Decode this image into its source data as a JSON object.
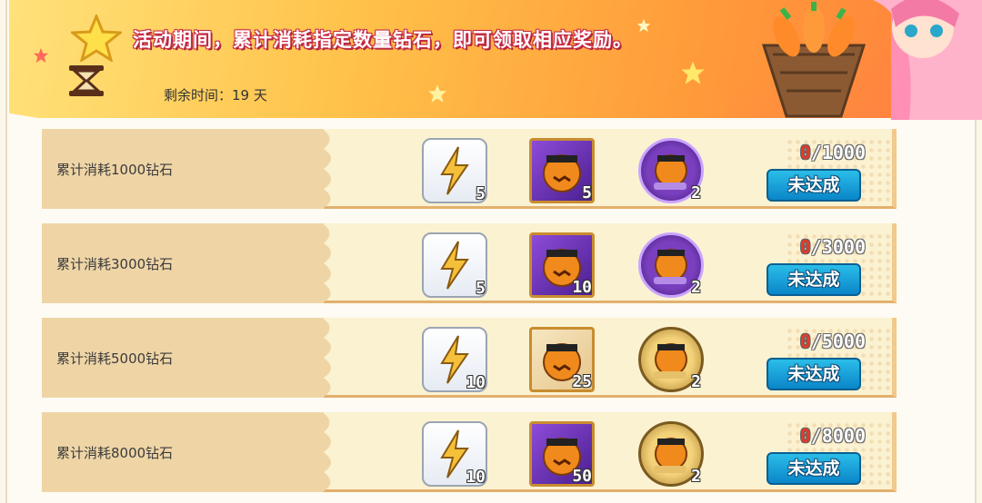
{
  "header": {
    "description": "活动期间，累计消耗指定数量钻石，即可领取相应奖励。",
    "time_label": "剩余时间：",
    "time_value": "19 天"
  },
  "tiers": [
    {
      "label": "累计消耗1000钻石",
      "current": "0",
      "target": "/1000",
      "items": [
        {
          "count": "5"
        },
        {
          "count": "5"
        },
        {
          "count": "2"
        }
      ],
      "button": "未达成"
    },
    {
      "label": "累计消耗3000钻石",
      "current": "0",
      "target": "/3000",
      "items": [
        {
          "count": "5"
        },
        {
          "count": "10"
        },
        {
          "count": "2"
        }
      ],
      "button": "未达成"
    },
    {
      "label": "累计消耗5000钻石",
      "current": "0",
      "target": "/5000",
      "items": [
        {
          "count": "10"
        },
        {
          "count": "25"
        },
        {
          "count": "2"
        }
      ],
      "button": "未达成"
    },
    {
      "label": "累计消耗8000钻石",
      "current": "0",
      "target": "/8000",
      "items": [
        {
          "count": "10"
        },
        {
          "count": "50"
        },
        {
          "count": "2"
        }
      ],
      "button": "未达成"
    }
  ],
  "colors": {
    "accent": "#ff9b3a",
    "button": "#0a86c9",
    "progress_current": "#e23b2a"
  },
  "icons": [
    "star-icon",
    "timer-icon",
    "lightning-card-icon",
    "pumpkin-box-icon",
    "pumpkin-medal-icon"
  ]
}
